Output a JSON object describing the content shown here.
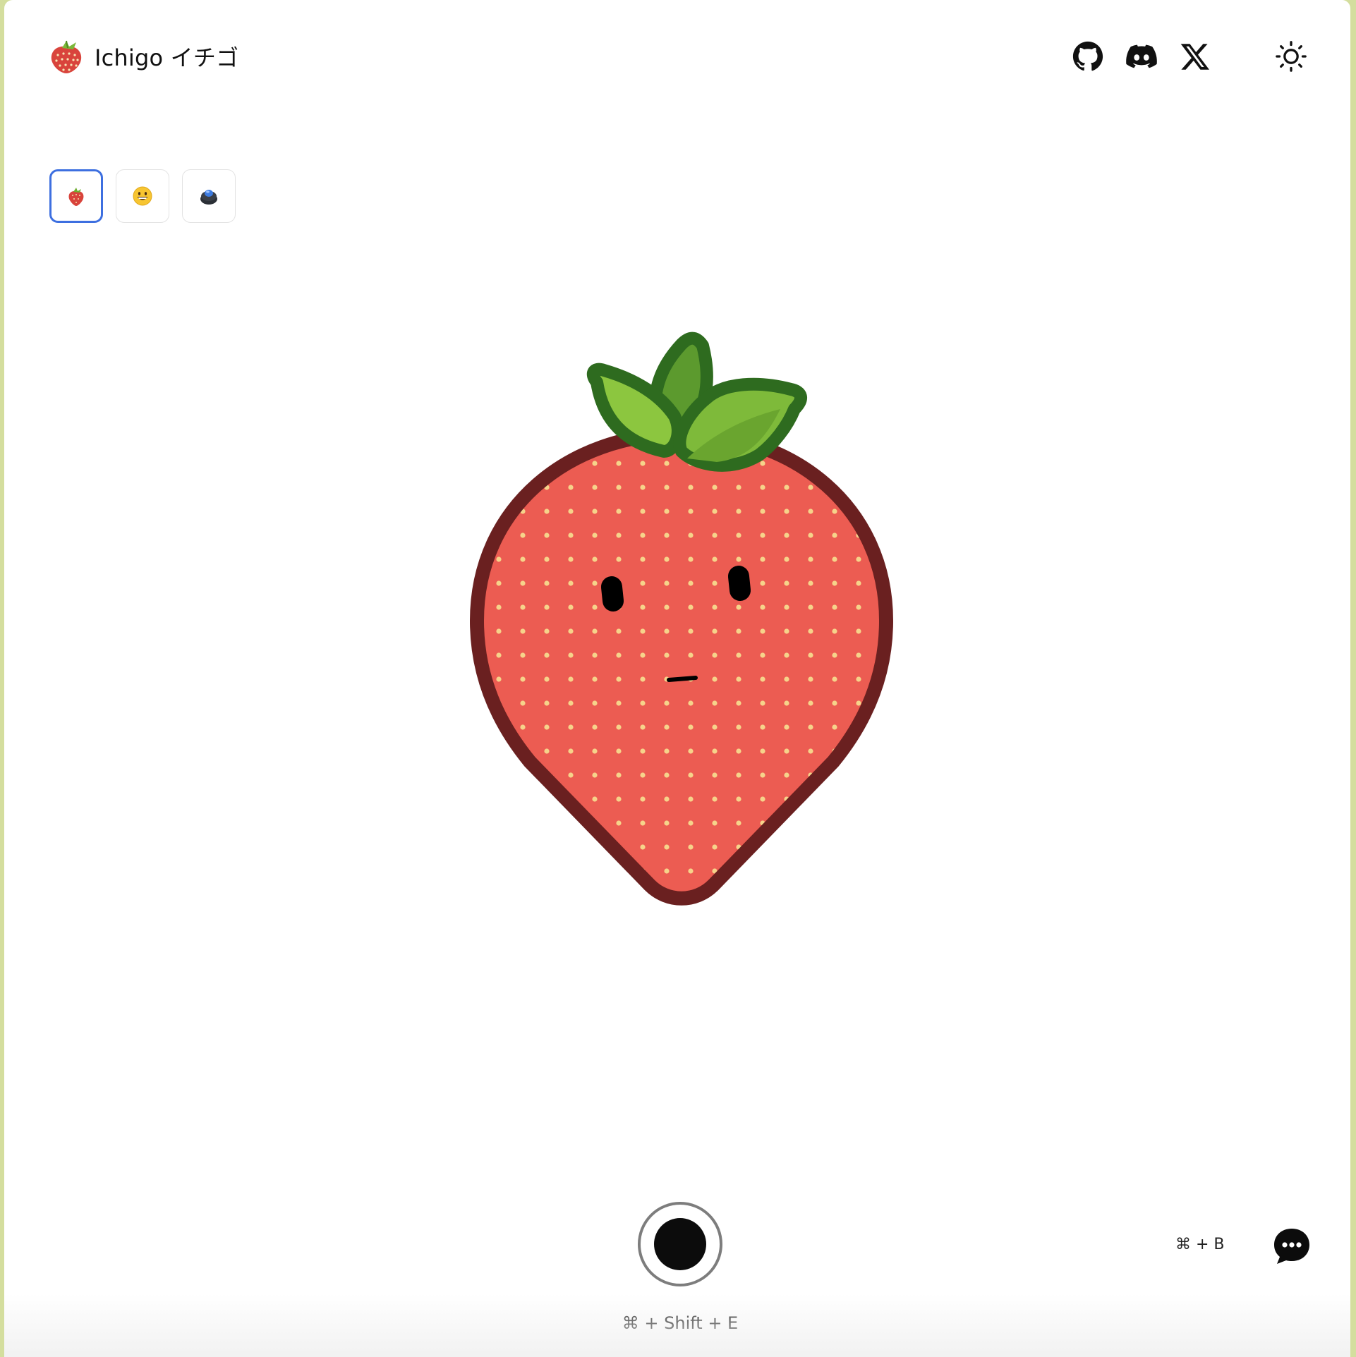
{
  "header": {
    "brand_title": "Ichigo イチゴ",
    "links": [
      {
        "name": "github-icon",
        "label": "GitHub"
      },
      {
        "name": "discord-icon",
        "label": "Discord"
      },
      {
        "name": "x-icon",
        "label": "X"
      }
    ],
    "theme_toggle_icon": "sun-icon"
  },
  "avatars": {
    "selected": "strawberry",
    "options": [
      {
        "id": "strawberry",
        "icon": "strawberry-icon"
      },
      {
        "id": "face",
        "icon": "smiley-face-icon"
      },
      {
        "id": "orb",
        "icon": "blue-orb-icon"
      }
    ]
  },
  "character": {
    "name": "strawberry-mascot",
    "colors": {
      "body": "#ec5c52",
      "outline": "#6a2020",
      "seeds": "#f6d38a",
      "leaf_light": "#8cc63f",
      "leaf_dark": "#2e6b1f",
      "face": "#000000"
    }
  },
  "controls": {
    "record_shortcut": "⌘ + Shift + E",
    "chat_shortcut": "⌘ + B"
  },
  "colors": {
    "frame_background": "#d4de9e",
    "accent": "#3d6fe0",
    "record_ring": "#7d7d7d"
  }
}
